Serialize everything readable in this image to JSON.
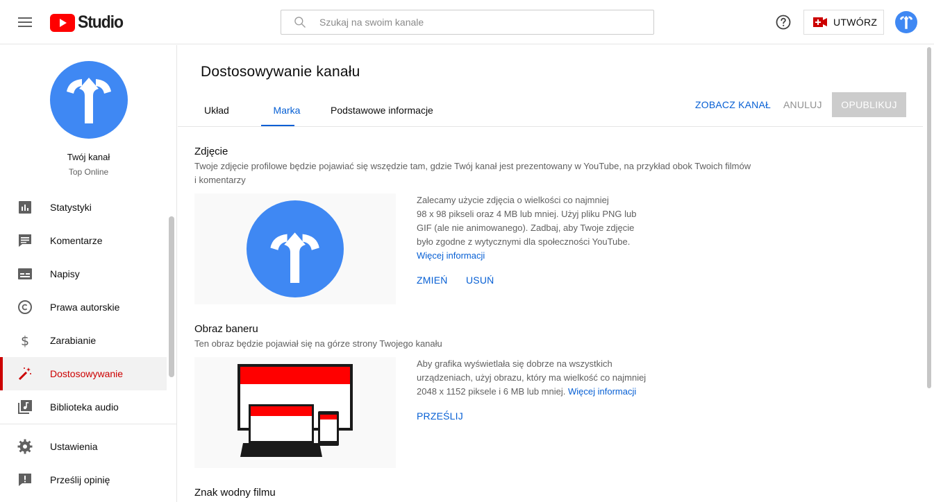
{
  "header": {
    "logo_text": "Studio",
    "search_placeholder": "Szukaj na swoim kanale",
    "create_label": "UTWÓRZ",
    "icons": {
      "menu": "hamburger-icon",
      "search": "search-icon",
      "help": "help-icon",
      "create": "video-camera-icon",
      "account": "account-avatar"
    }
  },
  "sidebar": {
    "channel_name": "Twój kanał",
    "channel_subtitle": "Top Online",
    "items": [
      {
        "label": "Statystyki",
        "icon": "analytics-icon"
      },
      {
        "label": "Komentarze",
        "icon": "comments-icon"
      },
      {
        "label": "Napisy",
        "icon": "subtitles-icon"
      },
      {
        "label": "Prawa autorskie",
        "icon": "copyright-icon"
      },
      {
        "label": "Zarabianie",
        "icon": "dollar-icon"
      },
      {
        "label": "Dostosowywanie",
        "icon": "magic-wand-icon",
        "active": true
      },
      {
        "label": "Biblioteka audio",
        "icon": "audio-library-icon"
      }
    ],
    "bottom_items": [
      {
        "label": "Ustawienia",
        "icon": "gear-icon"
      },
      {
        "label": "Prześlij opinię",
        "icon": "feedback-icon"
      }
    ]
  },
  "main": {
    "title": "Dostosowywanie kanału",
    "tabs": [
      {
        "label": "Układ"
      },
      {
        "label": "Marka",
        "active": true
      },
      {
        "label": "Podstawowe informacje"
      }
    ],
    "actions": {
      "view_channel": "ZOBACZ KANAŁ",
      "cancel": "ANULUJ",
      "publish": "OPUBLIKUJ"
    },
    "photo": {
      "title": "Zdjęcie",
      "desc_line1": "Twoje zdjęcie profilowe będzie pojawiać się wszędzie tam, gdzie Twój kanał jest prezentowany w YouTube, na przykład obok Twoich filmów",
      "desc_line2": "i komentarzy",
      "info_lines": [
        "Zalecamy użycie zdjęcia o wielkości co najmniej",
        "98 x 98 pikseli oraz 4 MB lub mniej. Użyj pliku PNG lub",
        "GIF (ale nie animowanego). Zadbaj, aby Twoje zdjęcie",
        "było zgodne z wytycznymi dla społeczności YouTube."
      ],
      "more_info": "Więcej informacji",
      "change": "ZMIEŃ",
      "remove": "USUŃ"
    },
    "banner": {
      "title": "Obraz baneru",
      "desc": "Ten obraz będzie pojawiał się na górze strony Twojego kanału",
      "info_lines": [
        "Aby grafika wyświetlała się dobrze na wszystkich",
        "urządzeniach, użyj obrazu, który ma wielkość co najmniej",
        "2048 x 1152 piksele i 6 MB lub mniej."
      ],
      "more_info": "Więcej informacji",
      "upload": "PRZEŚLIJ"
    },
    "watermark": {
      "title": "Znak wodny filmu"
    }
  },
  "colors": {
    "accent_blue": "#065fd4",
    "youtube_red": "#ff0000",
    "active_red": "#cc0000",
    "avatar_blue": "#3f88f3",
    "disabled_gray": "#cccccc"
  }
}
